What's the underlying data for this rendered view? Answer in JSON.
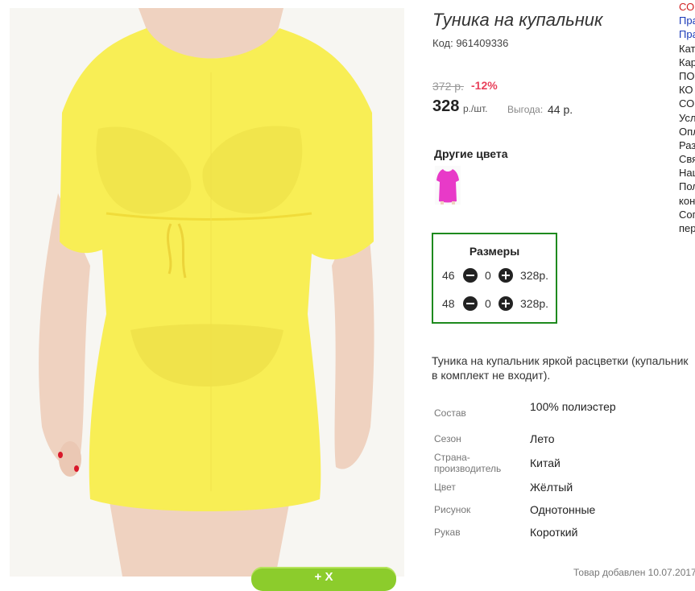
{
  "product": {
    "title": "Туника на купальник",
    "code": "Код: 961409336",
    "old_price": "372 р.",
    "discount": "-12%",
    "price": "328",
    "unit": "р./шт.",
    "benefit_label": "Выгода:",
    "benefit_value": "44 р.",
    "colors_title": "Другие цвета",
    "image_color": "#f8ee55",
    "swatch_color": "#e83ac8"
  },
  "sizes": {
    "title": "Размеры",
    "rows": [
      {
        "size": "46",
        "qty": "0",
        "price": "328р."
      },
      {
        "size": "48",
        "qty": "0",
        "price": "328р."
      }
    ]
  },
  "description": {
    "line1": "Туника на купальник яркой расцветки (купальник",
    "line2": "в комплект не входит)."
  },
  "properties": [
    {
      "key": "Состав",
      "value": "100% полиэстер"
    },
    {
      "key": "Сезон",
      "value": "Лето"
    },
    {
      "key": "Страна-производитель",
      "value": "Китай"
    },
    {
      "key": "Цвет",
      "value": "Жёлтый"
    },
    {
      "key": "Рисунок",
      "value": "Однотонные"
    },
    {
      "key": "Рукав",
      "value": "Короткий"
    }
  ],
  "added_date": "Товар добавлен 10.07.2017",
  "cart_button": "+ Х",
  "side_menu": [
    {
      "text": "СО",
      "color": "#d02020"
    },
    {
      "text": "Пра",
      "color": "#1a3ab8"
    },
    {
      "text": "Пра",
      "color": "#1a3ab8"
    },
    {
      "text": "Кат",
      "color": "#222222"
    },
    {
      "text": "Кар",
      "color": "#222222"
    },
    {
      "text": "ПО",
      "color": "#222222"
    },
    {
      "text": "КО",
      "color": "#222222"
    },
    {
      "text": "СО",
      "color": "#222222"
    },
    {
      "text": "Усл",
      "color": "#222222"
    },
    {
      "text": "Опл",
      "color": "#222222"
    },
    {
      "text": "Раз",
      "color": "#222222"
    },
    {
      "text": "Свя",
      "color": "#222222"
    },
    {
      "text": "Наш",
      "color": "#222222"
    },
    {
      "text": "Пол",
      "color": "#222222"
    },
    {
      "text": "кон",
      "color": "#222222"
    },
    {
      "text": "Сог",
      "color": "#222222"
    },
    {
      "text": "пер",
      "color": "#222222"
    }
  ]
}
